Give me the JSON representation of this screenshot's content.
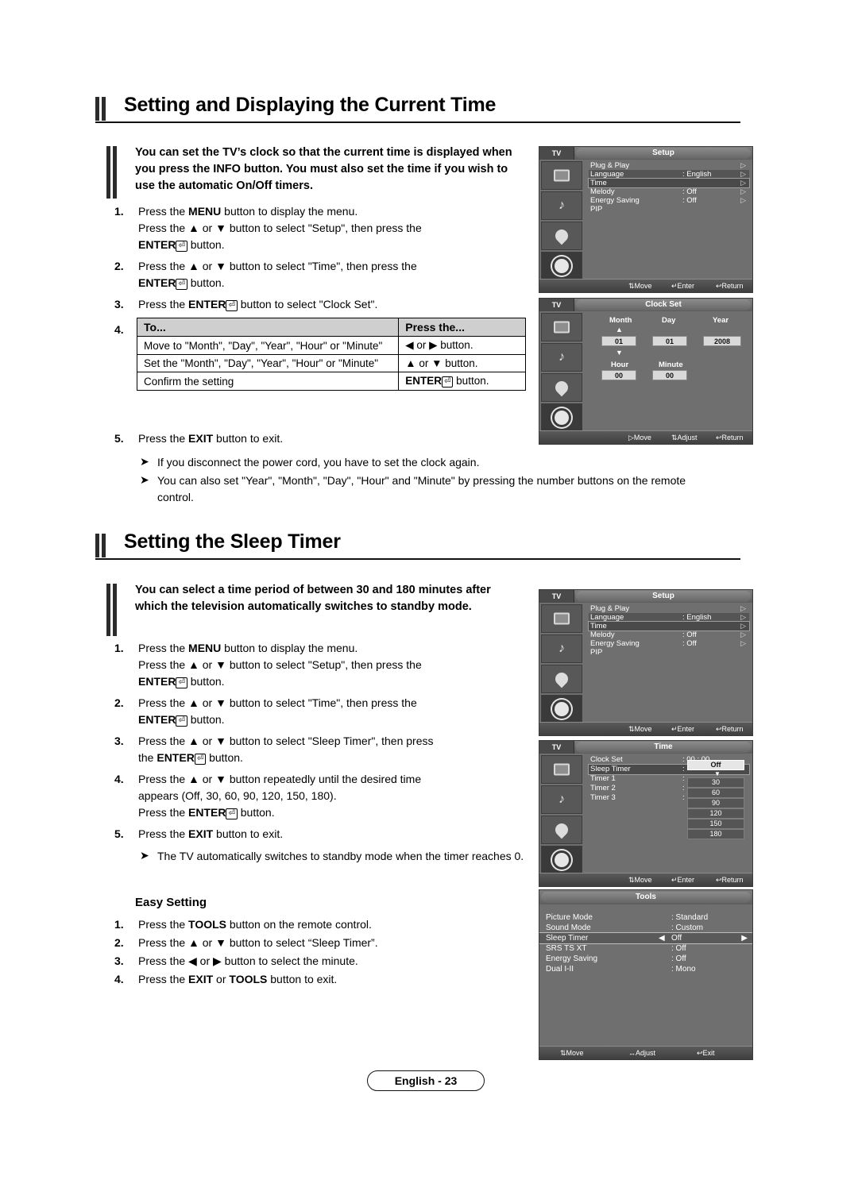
{
  "sections": [
    {
      "title": "Setting and Displaying the Current Time",
      "intro": "You can set the TV’s clock so that the current time is displayed when you press the INFO button. You must also set the time if you wish to use the automatic On/Off timers.",
      "steps": [
        {
          "num": "1.",
          "html": "Press the MENU button to display the menu. Press the ▲ or ▼ button to select \"Setup\", then press the ENTER button."
        },
        {
          "num": "2.",
          "html": "Press the ▲ or ▼ button to select \"Time\", then press the ENTER button."
        },
        {
          "num": "3.",
          "html": "Press the ENTER button to select \"Clock Set\"."
        },
        {
          "num": "4.",
          "html": "table"
        },
        {
          "num": "5.",
          "html": "Press the EXIT button to exit."
        }
      ],
      "table": {
        "headers": [
          "To...",
          "Press the..."
        ],
        "rows": [
          [
            "Move to \"Month\", \"Day\", \"Year\", \"Hour\" or \"Minute\"",
            "◀ or ▶ button."
          ],
          [
            "Set the \"Month\", \"Day\", \"Year\", \"Hour\" or \"Minute\"",
            "▲ or ▼ button."
          ],
          [
            "Confirm the setting",
            "ENTER button."
          ]
        ]
      },
      "notes": [
        "If you disconnect the power cord, you have to set the clock again.",
        "You can also set \"Year\", \"Month\", \"Day\", \"Hour\" and \"Minute\" by pressing the number buttons on the remote control."
      ]
    },
    {
      "title": "Setting the Sleep Timer",
      "intro": "You can select a time period of between 30 and 180 minutes after which the television automatically switches to standby mode.",
      "steps": [
        {
          "num": "1.",
          "html": "Press the MENU button to display the menu. Press the ▲ or ▼ button to select \"Setup\", then press the ENTER button."
        },
        {
          "num": "2.",
          "html": "Press the ▲ or ▼ button to select \"Time\", then press the ENTER button."
        },
        {
          "num": "3.",
          "html": "Press the ▲ or ▼ button to select \"Sleep Timer\", then press the ENTER button."
        },
        {
          "num": "4.",
          "html": "Press the ▲ or ▼ button repeatedly until the desired time appears (Off, 30, 60, 90, 120, 150, 180). Press the ENTER button."
        },
        {
          "num": "5.",
          "html": "Press the EXIT button to exit."
        }
      ],
      "notes": [
        "The TV automatically switches to standby mode when the timer reaches 0."
      ],
      "easy_setting": {
        "title": "Easy Setting",
        "steps": [
          {
            "num": "1.",
            "html": "Press the TOOLS button on the remote control."
          },
          {
            "num": "2.",
            "html": "Press the ▲ or ▼ button to select “Sleep Timer”."
          },
          {
            "num": "3.",
            "html": "Press the ◀ or ▶ button to select the minute."
          },
          {
            "num": "4.",
            "html": "Press the EXIT or TOOLS button to exit."
          }
        ]
      }
    }
  ],
  "osd": {
    "setup1": {
      "tv_tab": "TV",
      "title": "Setup",
      "rows": [
        {
          "label": "Plug & Play",
          "value": "",
          "arrow": "▷"
        },
        {
          "label": "Language",
          "value": ": English",
          "arrow": "▷"
        },
        {
          "label": "Time",
          "value": "",
          "arrow": "▷"
        },
        {
          "label": "Melody",
          "value": ": Off",
          "arrow": "▷"
        },
        {
          "label": "Energy Saving",
          "value": ": Off",
          "arrow": "▷"
        },
        {
          "label": "PIP",
          "value": "",
          "arrow": ""
        }
      ],
      "footer": {
        "move": "Move",
        "enter": "Enter",
        "return": "Return"
      }
    },
    "clockset": {
      "tv_tab": "TV",
      "title": "Clock Set",
      "labels": {
        "month": "Month",
        "day": "Day",
        "year": "Year",
        "hour": "Hour",
        "minute": "Minute"
      },
      "values": {
        "month": "01",
        "day": "01",
        "year": "2008",
        "hour": "00",
        "minute": "00"
      },
      "footer": {
        "move": "Move",
        "adjust": "Adjust",
        "return": "Return"
      }
    },
    "setup2": {
      "tv_tab": "TV",
      "title": "Setup",
      "rows": [
        {
          "label": "Plug & Play",
          "value": "",
          "arrow": "▷"
        },
        {
          "label": "Language",
          "value": ": English",
          "arrow": "▷"
        },
        {
          "label": "Time",
          "value": "",
          "arrow": "▷"
        },
        {
          "label": "Melody",
          "value": ": Off",
          "arrow": "▷"
        },
        {
          "label": "Energy Saving",
          "value": ": Off",
          "arrow": "▷"
        },
        {
          "label": "PIP",
          "value": "",
          "arrow": ""
        }
      ],
      "footer": {
        "move": "Move",
        "enter": "Enter",
        "return": "Return"
      }
    },
    "time": {
      "tv_tab": "TV",
      "title": "Time",
      "rows": [
        {
          "label": "Clock Set",
          "value": ": 00 : 00"
        },
        {
          "label": "Sleep Timer",
          "value": ":"
        },
        {
          "label": "Timer 1",
          "value": ":"
        },
        {
          "label": "Timer 2",
          "value": ":"
        },
        {
          "label": "Timer 3",
          "value": ":"
        }
      ],
      "options": [
        "Off",
        "30",
        "60",
        "90",
        "120",
        "150",
        "180"
      ],
      "selected_option": "Off",
      "footer": {
        "move": "Move",
        "enter": "Enter",
        "return": "Return"
      }
    },
    "tools": {
      "title": "Tools",
      "rows": [
        {
          "label": "Picture Mode",
          "value": ": Standard",
          "selected": false
        },
        {
          "label": "Sound Mode",
          "value": ": Custom",
          "selected": false
        },
        {
          "label": "Sleep Timer",
          "value": "Off",
          "selected": true,
          "left_arrow": "◀",
          "right_arrow": "▶"
        },
        {
          "label": "SRS TS XT",
          "value": ": Off",
          "selected": false
        },
        {
          "label": "Energy Saving",
          "value": ": Off",
          "selected": false
        },
        {
          "label": "Dual I-II",
          "value": ": Mono",
          "selected": false
        }
      ],
      "footer": {
        "move": "Move",
        "adjust": "Adjust",
        "exit": "Exit"
      }
    }
  },
  "page_label": "English - 23"
}
